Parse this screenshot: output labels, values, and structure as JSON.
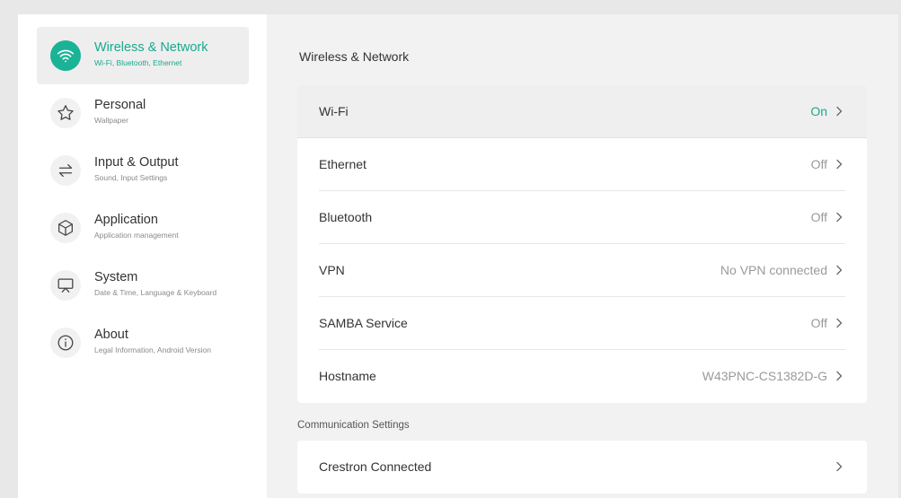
{
  "colors": {
    "accent": "#1bb396",
    "accent_text": "#1aa98d",
    "background": "#f2f2f2",
    "card": "#ffffff"
  },
  "sidebar": {
    "items": [
      {
        "title": "Wireless & Network",
        "subtitle": "Wi-Fi, Bluetooth, Ethernet",
        "icon": "wifi-icon",
        "active": true
      },
      {
        "title": "Personal",
        "subtitle": "Wallpaper",
        "icon": "star-icon",
        "active": false
      },
      {
        "title": "Input & Output",
        "subtitle": "Sound, Input Settings",
        "icon": "swap-arrows-icon",
        "active": false
      },
      {
        "title": "Application",
        "subtitle": "Application management",
        "icon": "cube-icon",
        "active": false
      },
      {
        "title": "System",
        "subtitle": "Date & Time, Language & Keyboard",
        "icon": "monitor-icon",
        "active": false
      },
      {
        "title": "About",
        "subtitle": "Legal Information, Android Version",
        "icon": "info-icon",
        "active": false
      }
    ]
  },
  "main": {
    "section_title": "Wireless & Network",
    "network_rows": [
      {
        "label": "Wi-Fi",
        "value": "On"
      },
      {
        "label": "Ethernet",
        "value": "Off"
      },
      {
        "label": "Bluetooth",
        "value": "Off"
      },
      {
        "label": "VPN",
        "value": "No VPN connected"
      },
      {
        "label": "SAMBA Service",
        "value": "Off"
      },
      {
        "label": "Hostname",
        "value": "W43PNC-CS1382D-G"
      }
    ],
    "communication": {
      "title": "Communication Settings",
      "rows": [
        {
          "label": "Crestron Connected",
          "value": ""
        }
      ]
    }
  }
}
